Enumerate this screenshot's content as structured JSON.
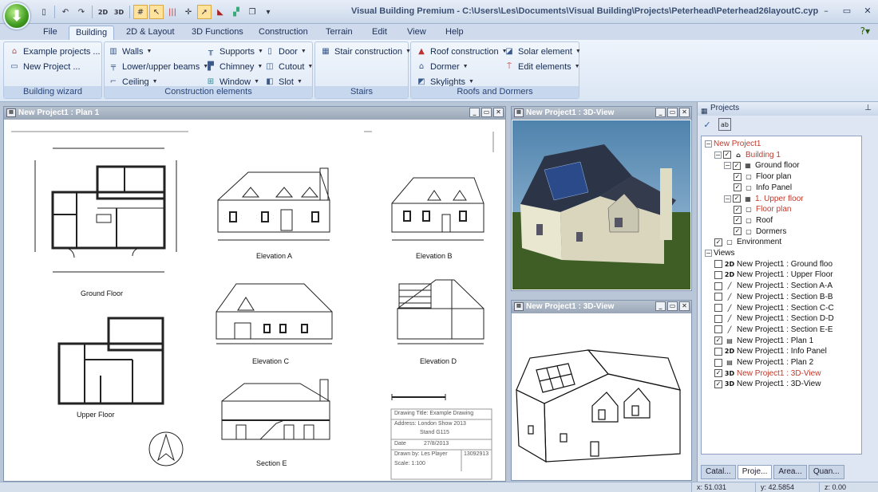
{
  "app": {
    "title": "Visual Building Premium - C:\\Users\\Les\\Documents\\Visual Building\\Projects\\Peterhead\\Peterhead26layoutC.cyp",
    "qat": [
      "2D",
      "3D"
    ]
  },
  "tabs": [
    "File",
    "Building",
    "2D & Layout",
    "3D Functions",
    "Construction",
    "Terrain",
    "Edit",
    "View",
    "Help"
  ],
  "ribbon": {
    "building_wizard": {
      "label": "Building wizard",
      "items": [
        "Example projects ...",
        "New Project ..."
      ]
    },
    "construction_elements": {
      "label": "Construction elements",
      "col1": [
        "Walls",
        "Lower/upper beams",
        "Ceiling"
      ],
      "col2": [
        "Supports",
        "Chimney",
        "Window"
      ],
      "col3": [
        "Door",
        "Cutout",
        "Slot"
      ]
    },
    "stairs": {
      "label": "Stairs",
      "items": [
        "Stair construction"
      ]
    },
    "roofs_dormers": {
      "label": "Roofs and Dormers",
      "col1": [
        "Roof construction",
        "Dormer",
        "Skylights"
      ],
      "col2": [
        "Solar element",
        "Edit elements"
      ]
    }
  },
  "plan_window": {
    "title": "New Project1 : Plan 1",
    "labels": {
      "ground_floor": "Ground Floor",
      "upper_floor": "Upper Floor",
      "elev_a": "Elevation A",
      "elev_b": "Elevation B",
      "elev_c": "Elevation C",
      "elev_d": "Elevation D",
      "section_e": "Section E"
    },
    "title_block": {
      "drawing_title": "Drawing Title: Example Drawing",
      "address_1": "Address: London Show 2013",
      "address_2": "Stand G115",
      "date_label": "Date",
      "date_value": "27/8/2013",
      "drawn_by": "Drawn by: Les Player",
      "scale": "Scale: 1:100",
      "number": "13092913"
    }
  },
  "view3d_top": {
    "title": "New Project1 : 3D-View"
  },
  "view3d_bottom": {
    "title": "New Project1 : 3D-View"
  },
  "projects": {
    "title": "Projects",
    "tree": [
      {
        "label": "New Project1",
        "level": 0,
        "red": true,
        "exp": "−"
      },
      {
        "label": "Building 1",
        "level": 1,
        "red": true,
        "cb": "✓",
        "ico": "⌂",
        "exp": "−"
      },
      {
        "label": "Ground floor",
        "level": 2,
        "cb": "✓",
        "ico": "▦",
        "exp": "−"
      },
      {
        "label": "Floor plan",
        "level": 3,
        "cb": "✓",
        "ico": "▢"
      },
      {
        "label": "Info Panel",
        "level": 3,
        "cb": "✓",
        "ico": "▢"
      },
      {
        "label": "1. Upper floor",
        "level": 2,
        "red": true,
        "cb": "✓",
        "ico": "▦",
        "exp": "−"
      },
      {
        "label": "Floor plan",
        "level": 3,
        "red": true,
        "cb": "✓",
        "ico": "▢"
      },
      {
        "label": "Roof",
        "level": 3,
        "cb": "✓",
        "ico": "▢"
      },
      {
        "label": "Dormers",
        "level": 3,
        "cb": "✓",
        "ico": "▢"
      },
      {
        "label": "Environment",
        "level": 1,
        "cb": "✓",
        "ico": "▢"
      },
      {
        "label": "Views",
        "level": 0,
        "exp": "−"
      },
      {
        "label": "New Project1 : Ground floo",
        "level": 1,
        "cb": "",
        "ico": "2D"
      },
      {
        "label": "New Project1 : Upper Floor",
        "level": 1,
        "cb": "",
        "ico": "2D"
      },
      {
        "label": "New Project1 : Section A-A",
        "level": 1,
        "cb": "",
        "ico": "╱"
      },
      {
        "label": "New Project1 : Section B-B",
        "level": 1,
        "cb": "",
        "ico": "╱"
      },
      {
        "label": "New Project1 : Section C-C",
        "level": 1,
        "cb": "",
        "ico": "╱"
      },
      {
        "label": "New Project1 : Section D-D",
        "level": 1,
        "cb": "",
        "ico": "╱"
      },
      {
        "label": "New Project1 : Section E-E",
        "level": 1,
        "cb": "",
        "ico": "╱"
      },
      {
        "label": "New Project1 : Plan 1",
        "level": 1,
        "cb": "✓",
        "ico": "▤"
      },
      {
        "label": "New Project1 : Info Panel",
        "level": 1,
        "cb": "",
        "ico": "2D"
      },
      {
        "label": "New Project1 : Plan 2",
        "level": 1,
        "cb": "",
        "ico": "▤"
      },
      {
        "label": "New Project1 : 3D-View",
        "level": 1,
        "red": true,
        "cb": "✓",
        "ico": "3D"
      },
      {
        "label": "New Project1 : 3D-View",
        "level": 1,
        "cb": "✓",
        "ico": "3D"
      }
    ],
    "bottom_tabs": [
      "Catal...",
      "Proje...",
      "Area...",
      "Quan..."
    ]
  },
  "status": {
    "x": "x: 51.031",
    "y": "y: 42.5854",
    "z": "z: 0.00"
  }
}
